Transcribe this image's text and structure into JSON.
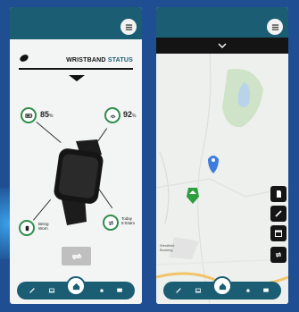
{
  "colors": {
    "teal": "#1b5d73",
    "green": "#2e8e4a",
    "background": "#1f4f92"
  },
  "phone1": {
    "header": {
      "title_prefix": "WRISTBAND",
      "title_suffix": "STATUS"
    },
    "metrics": {
      "battery": {
        "value": "85",
        "unit": "%"
      },
      "signal": {
        "value": "92",
        "unit": "%"
      },
      "status": {
        "label_line1": "Being",
        "label_line2": "Worn"
      },
      "sync": {
        "label_line1": "Today",
        "label_line2": "8:03am"
      }
    },
    "icons": [
      "menu-icon",
      "wristband-icon",
      "battery-icon",
      "signal-icon",
      "worn-icon",
      "sync-icon"
    ]
  },
  "phone2": {
    "map_labels": {
      "label1": "Westfield",
      "label2": "Booking"
    },
    "icons": [
      "menu-icon",
      "chevron-down-icon",
      "location-pin-icon",
      "home-marker-icon",
      "document-icon",
      "pencil-icon",
      "calendar-icon",
      "sync-icon"
    ]
  },
  "nav_icons": [
    "pen-icon",
    "laptop-icon",
    "home-icon",
    "bell-icon",
    "chat-icon"
  ]
}
